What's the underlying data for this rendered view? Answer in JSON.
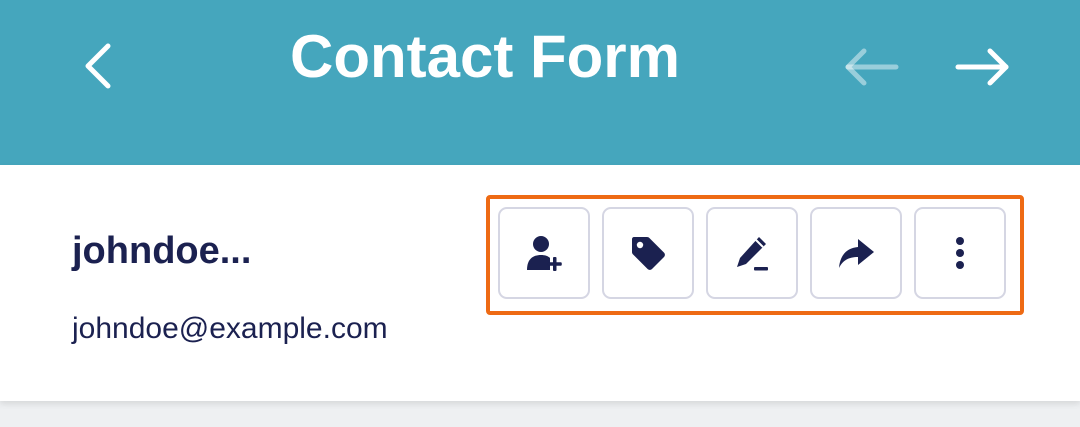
{
  "header": {
    "title": "Contact Form",
    "background_color": "#45a6bd",
    "back_icon": "chevron-left-icon",
    "prev_icon": "arrow-left-icon",
    "next_icon": "arrow-right-icon",
    "prev_disabled": true
  },
  "contact": {
    "name": "johndoe...",
    "email": "johndoe@example.com"
  },
  "actions": [
    {
      "name": "add-contact",
      "icon": "user-plus-icon"
    },
    {
      "name": "tag",
      "icon": "tag-icon"
    },
    {
      "name": "edit",
      "icon": "pencil-icon"
    },
    {
      "name": "share",
      "icon": "share-arrow-icon"
    },
    {
      "name": "more",
      "icon": "more-vertical-icon"
    }
  ],
  "colors": {
    "text_dark": "#1b2150",
    "highlight_border": "#ee6a14",
    "button_border": "#d5d6e3"
  }
}
